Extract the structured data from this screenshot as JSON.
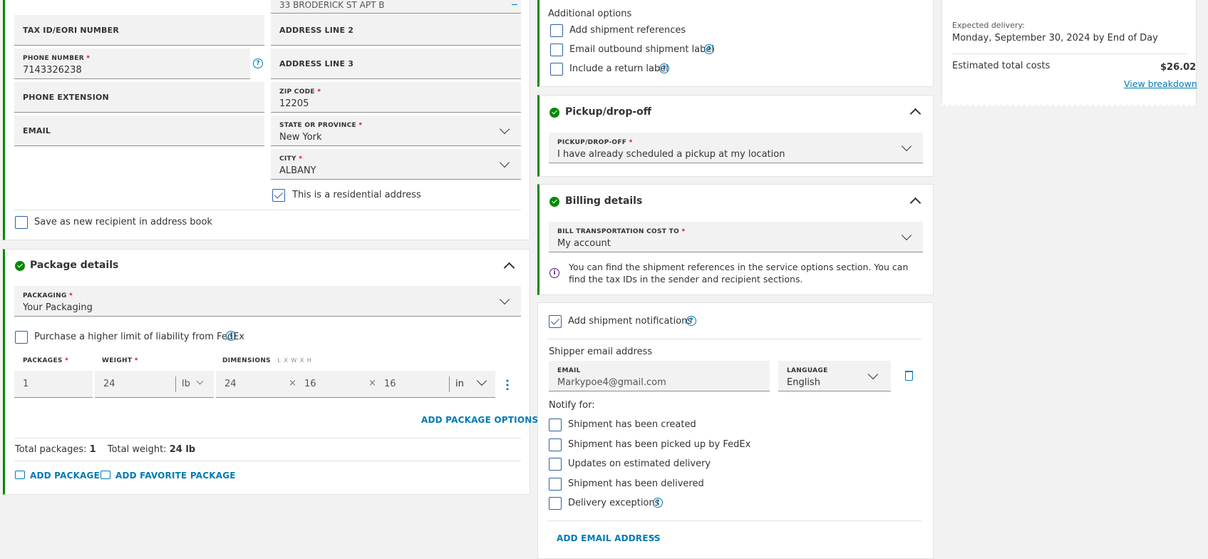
{
  "recipient": {
    "address_line1_value": "33 BRODERICK ST APT B",
    "tax_id_label": "TAX ID/EORI NUMBER",
    "address_line2_label": "ADDRESS LINE 2",
    "phone_label": "PHONE NUMBER",
    "phone_value": "7143326238",
    "address_line3_label": "ADDRESS LINE 3",
    "phone_ext_label": "PHONE EXTENSION",
    "zip_label": "ZIP CODE",
    "zip_value": "12205",
    "email_label": "EMAIL",
    "state_label": "STATE OR PROVINCE",
    "state_value": "New York",
    "city_label": "CITY",
    "city_value": "ALBANY",
    "residential_label": "This is a residential address",
    "save_recipient_label": "Save as new recipient in address book"
  },
  "package": {
    "title": "Package details",
    "packaging_label": "PACKAGING",
    "packaging_value": "Your Packaging",
    "liability_label": "Purchase a higher limit of liability from FedEx",
    "packages_label": "PACKAGES",
    "weight_label": "WEIGHT",
    "dimensions_label": "DIMENSIONS",
    "dimensions_hint": "L x W x H",
    "packages_value": "1",
    "weight_value": "24",
    "weight_unit": "lb",
    "dim_l": "24",
    "dim_w": "16",
    "dim_h": "16",
    "dim_unit": "in",
    "times_symbol": "×",
    "add_options": "ADD PACKAGE OPTIONS",
    "total_packages_label": "Total packages:",
    "total_packages_value": "1",
    "total_weight_label": "Total weight:",
    "total_weight_value": "24 lb",
    "add_package": "ADD PACKAGE",
    "add_favorite": "ADD FAVORITE PACKAGE"
  },
  "options": {
    "title": "Additional options",
    "items": [
      "Add shipment references",
      "Email outbound shipment label",
      "Include a return label"
    ]
  },
  "pickup": {
    "title": "Pickup/drop-off",
    "field_label": "PICKUP/DROP-OFF",
    "field_value": "I have already scheduled a pickup at my location"
  },
  "billing": {
    "title": "Billing details",
    "field_label": "BILL TRANSPORTATION COST TO",
    "field_value": "My account",
    "info": "You can find the shipment references in the service options section. You can find the tax IDs in the sender and recipient sections."
  },
  "notifications": {
    "add_label": "Add shipment notifications",
    "shipper_email_title": "Shipper email address",
    "email_label": "EMAIL",
    "email_value": "Markypoe4@gmail.com",
    "language_label": "LANGUAGE",
    "language_value": "English",
    "notify_for": "Notify for:",
    "items": [
      "Shipment has been created",
      "Shipment has been picked up by FedEx",
      "Updates on estimated delivery",
      "Shipment has been delivered",
      "Delivery exceptions"
    ],
    "add_email": "ADD EMAIL ADDRESS"
  },
  "summary": {
    "expected_label": "Expected delivery:",
    "expected_value": "Monday, September 30, 2024 by End of Day",
    "total_label": "Estimated total costs",
    "total_value": "$26.02",
    "breakdown": "View breakdown"
  },
  "icons": {
    "help": "?",
    "info": "i"
  },
  "colors": {
    "accent": "#007ab7",
    "success": "#008a00",
    "required": "#de002e",
    "info": "#4d148c"
  }
}
